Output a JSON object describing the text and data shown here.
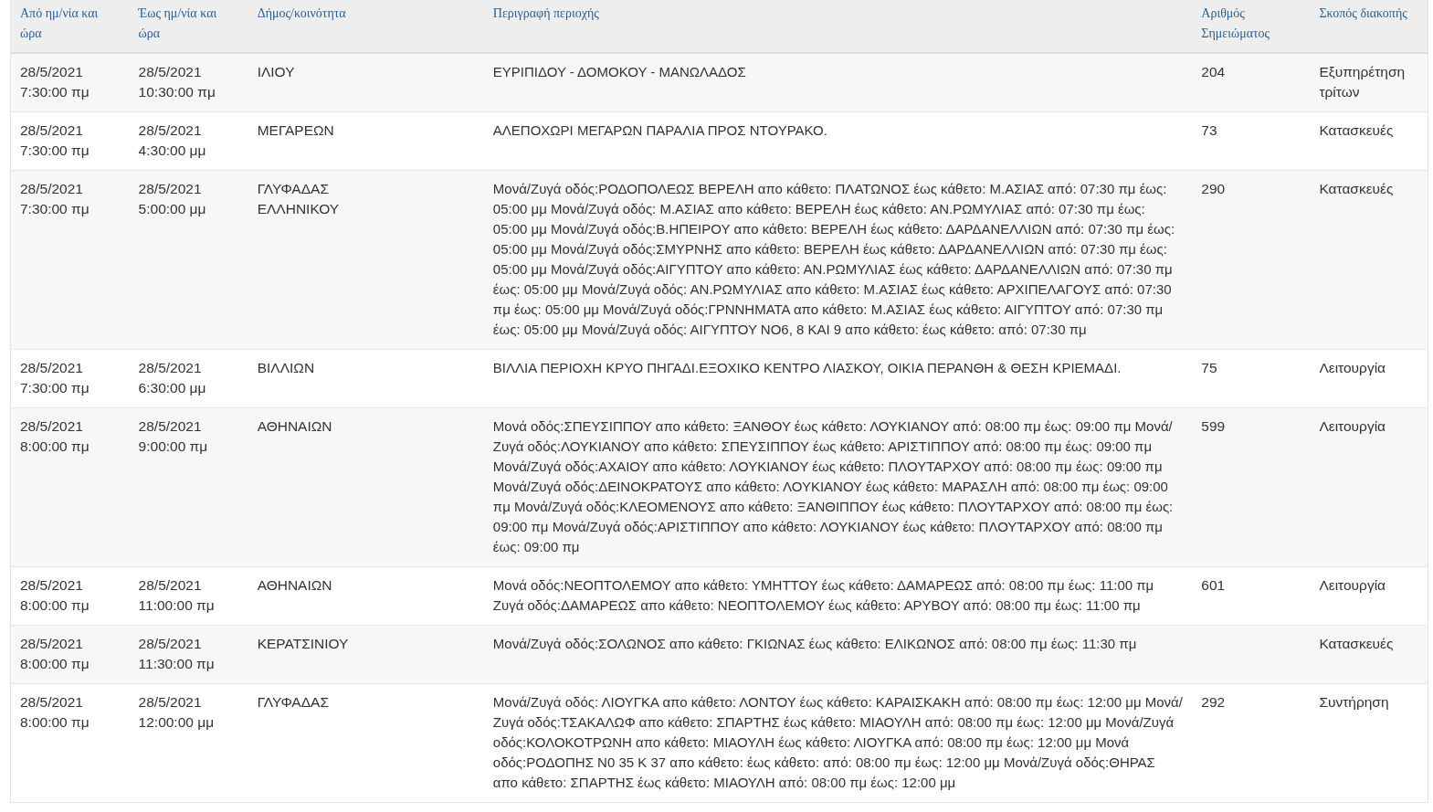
{
  "table": {
    "columns": [
      "Από ημ/νία και ώρα",
      "Έως ημ/νία και ώρα",
      "Δήμος/κοινότητα",
      "Περιγραφή περιοχής",
      "Αριθμός Σημειώματος",
      "Σκοπός διακοπής"
    ],
    "rows": [
      {
        "from": [
          "28/5/2021",
          "7:30:00 πμ"
        ],
        "to": [
          "28/5/2021",
          "10:30:00 πμ"
        ],
        "municipality": "ΙΛΙΟΥ",
        "description": "ΕΥΡΙΠΙΔΟΥ - ΔΟΜΟΚΟΥ - ΜΑΝΩΛΑΔΟΣ",
        "note_number": "204",
        "purpose": "Εξυπηρέτηση τρίτων"
      },
      {
        "from": [
          "28/5/2021",
          "7:30:00 πμ"
        ],
        "to": [
          "28/5/2021",
          "4:30:00 μμ"
        ],
        "municipality": "ΜΕΓΑΡΕΩΝ",
        "description": "ΑΛΕΠΟΧΩΡΙ ΜΕΓΑΡΩΝ ΠΑΡΑΛΙΑ ΠΡΟΣ ΝΤΟΥΡΑΚΟ.",
        "note_number": "73",
        "purpose": "Κατασκευές"
      },
      {
        "from": [
          "28/5/2021",
          "7:30:00 πμ"
        ],
        "to": [
          "28/5/2021",
          "5:00:00 μμ"
        ],
        "municipality": "ΓΛΥΦΑΔΑΣ ΕΛΛΗΝΙΚΟΥ",
        "description": "Μονά/Ζυγά οδός:ΡΟΔΟΠΟΛΕΩΣ ΒΕΡΕΛΗ απο κάθετο: ΠΛΑΤΩΝΟΣ έως κάθετο: Μ.ΑΣΙΑΣ από: 07:30 πμ έως: 05:00 μμ Μονά/Ζυγά οδός: Μ.ΑΣΙΑΣ απο κάθετο: ΒΕΡΕΛΗ έως κάθετο: ΑΝ.ΡΩΜΥΛΙΑΣ από: 07:30 πμ έως: 05:00 μμ Μονά/Ζυγά οδός:Β.ΗΠΕΙΡΟΥ απο κάθετο: ΒΕΡΕΛΗ έως κάθετο: ΔΑΡΔΑΝΕΛΛΙΩΝ από: 07:30 πμ έως: 05:00 μμ Μονά/Ζυγά οδός:ΣΜΥΡΝΗΣ απο κάθετο: ΒΕΡΕΛΗ έως κάθετο: ΔΑΡΔΑΝΕΛΛΙΩΝ από: 07:30 πμ έως: 05:00 μμ Μονά/Ζυγά οδός:ΑΙΓΥΠΤΟΥ απο κάθετο: ΑΝ.ΡΩΜΥΛΙΑΣ έως κάθετο: ΔΑΡΔΑΝΕΛΛΙΩΝ από: 07:30 πμ έως: 05:00 μμ Μονά/Ζυγά οδός: ΑΝ.ΡΩΜΥΛΙΑΣ απο κάθετο: Μ.ΑΣΙΑΣ έως κάθετο: ΑΡΧΙΠΕΛΑΓΟΥΣ από: 07:30 πμ έως: 05:00 μμ Μονά/Ζυγά οδός:ΓΡΝΝΗΜΑΤΑ απο κάθετο: Μ.ΑΣΙΑΣ έως κάθετο: ΑΙΓΥΠΤΟΥ από: 07:30 πμ έως: 05:00 μμ Μονά/Ζυγά οδός: ΑΙΓΥΠΤΟΥ ΝΟ6, 8 ΚΑΙ 9 απο κάθετο: έως κάθετο: από: 07:30 πμ",
        "note_number": "290",
        "purpose": "Κατασκευές"
      },
      {
        "from": [
          "28/5/2021",
          "7:30:00 πμ"
        ],
        "to": [
          "28/5/2021",
          "6:30:00 μμ"
        ],
        "municipality": "ΒΙΛΛΙΩΝ",
        "description": "ΒΙΛΛΙΑ ΠΕΡΙΟΧΗ ΚΡΥΟ ΠΗΓΑΔΙ.ΕΞΟΧΙΚΟ ΚΕΝΤΡΟ ΛΙΑΣΚΟΥ, ΟΙΚΙΑ ΠΕΡΑΝΘΗ & ΘΕΣΗ ΚΡΙΕΜΑΔΙ.",
        "note_number": "75",
        "purpose": "Λειτουργία"
      },
      {
        "from": [
          "28/5/2021",
          "8:00:00 πμ"
        ],
        "to": [
          "28/5/2021",
          "9:00:00 πμ"
        ],
        "municipality": "ΑΘΗΝΑΙΩΝ",
        "description": "Μονά οδός:ΣΠΕΥΣΙΠΠΟΥ απο κάθετο: ΞΑΝΘΟΥ έως κάθετο: ΛΟΥΚΙΑΝΟΥ από: 08:00 πμ έως: 09:00 πμ Μονά/Ζυγά οδός:ΛΟΥΚΙΑΝΟΥ απο κάθετο: ΣΠΕΥΣΙΠΠΟΥ έως κάθετο: ΑΡΙΣΤΙΠΠΟΥ από: 08:00 πμ έως: 09:00 πμ Μονά/Ζυγά οδός:ΑΧΑΙΟΥ απο κάθετο: ΛΟΥΚΙΑΝΟΥ έως κάθετο: ΠΛΟΥΤΑΡΧΟΥ από: 08:00 πμ έως: 09:00 πμ Μονά/Ζυγά οδός:ΔΕΙΝΟΚΡΑΤΟΥΣ απο κάθετο: ΛΟΥΚΙΑΝΟΥ έως κάθετο: ΜΑΡΑΣΛΗ από: 08:00 πμ έως: 09:00 πμ Μονά/Ζυγά οδός:ΚΛΕΟΜΕΝΟΥΣ απο κάθετο: ΞΑΝΘΙΠΠΟΥ έως κάθετο: ΠΛΟΥΤΑΡΧΟΥ από: 08:00 πμ έως: 09:00 πμ Μονά/Ζυγά οδός:ΑΡΙΣΤΙΠΠΟΥ απο κάθετο: ΛΟΥΚΙΑΝΟΥ έως κάθετο: ΠΛΟΥΤΑΡΧΟΥ από: 08:00 πμ έως: 09:00 πμ",
        "note_number": "599",
        "purpose": "Λειτουργία"
      },
      {
        "from": [
          "28/5/2021",
          "8:00:00 πμ"
        ],
        "to": [
          "28/5/2021",
          "11:00:00 πμ"
        ],
        "municipality": "ΑΘΗΝΑΙΩΝ",
        "description": "Μονά οδός:ΝΕΟΠΤΟΛΕΜΟΥ απο κάθετο: ΥΜΗΤΤΟΥ έως κάθετο: ΔΑΜΑΡΕΩΣ από: 08:00 πμ έως: 11:00 πμ Ζυγά οδός:ΔΑΜΑΡΕΩΣ απο κάθετο: ΝΕΟΠΤΟΛΕΜΟΥ έως κάθετο: ΑΡΥΒΟΥ από: 08:00 πμ έως: 11:00 πμ",
        "note_number": "601",
        "purpose": "Λειτουργία"
      },
      {
        "from": [
          "28/5/2021",
          "8:00:00 πμ"
        ],
        "to": [
          "28/5/2021",
          "11:30:00 πμ"
        ],
        "municipality": "ΚΕΡΑΤΣΙΝΙΟΥ",
        "description": "Μονά/Ζυγά οδός:ΣΟΛΩΝΟΣ απο κάθετο: ΓΚΙΩΝΑΣ έως κάθετο: ΕΛΙΚΩΝΟΣ από: 08:00 πμ έως: 11:30 πμ",
        "purpose": "Κατασκευές"
      },
      {
        "from": [
          "28/5/2021",
          "8:00:00 πμ"
        ],
        "to": [
          "28/5/2021",
          "12:00:00 μμ"
        ],
        "municipality": "ΓΛΥΦΑΔΑΣ",
        "description": "Μονά/Ζυγά οδός: ΛΙΟΥΓΚΑ απο κάθετο: ΛΟΝΤΟΥ έως κάθετο: ΚΑΡΑΙΣΚΑΚΗ από: 08:00 πμ έως: 12:00 μμ Μονά/Ζυγά οδός:ΤΣΑΚΑΛΩΦ απο κάθετο: ΣΠΑΡΤΗΣ έως κάθετο: ΜΙΑΟΥΛΗ από: 08:00 πμ έως: 12:00 μμ Μονά/Ζυγά οδός:ΚΟΛΟΚΟΤΡΩΝΗ απο κάθετο: ΜΙΑΟΥΛΗ έως κάθετο: ΛΙΟΥΓΚΑ από: 08:00 πμ έως: 12:00 μμ Μονά οδός:ΡΟΔΟΠΗΣ Ν0 35 Κ 37 απο κάθετο: έως κάθετο: από: 08:00 πμ έως: 12:00 μμ Μονά/Ζυγά οδός:ΘΗΡΑΣ απο κάθετο: ΣΠΑΡΤΗΣ έως κάθετο: ΜΙΑΟΥΛΗ από: 08:00 πμ έως: 12:00 μμ",
        "note_number": "292",
        "purpose": "Συντήρηση"
      }
    ]
  }
}
